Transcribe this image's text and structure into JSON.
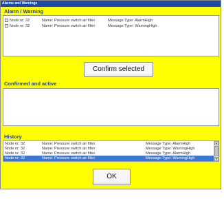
{
  "window": {
    "title": "Alarms and Warnings"
  },
  "alarm_section": {
    "label": "Alarm / Warning",
    "items": [
      {
        "node": "Node nr: 32",
        "name": "Name: Pressure switch air filter",
        "type": "Message Type: AlarmHigh"
      },
      {
        "node": "Node nr: 32",
        "name": "Name: Pressure switch air filter",
        "type": "Message Type: WarningHigh"
      }
    ]
  },
  "confirm_button": {
    "label": "Confirm selected"
  },
  "confirmed_section": {
    "label": "Confirmed and active"
  },
  "history_section": {
    "label": "History",
    "items": [
      {
        "node": "Node nr: 32",
        "name": "Name: Pressure switch air filter",
        "type": "Message Type: AlarmHigh"
      },
      {
        "node": "Node nr: 32",
        "name": "Name: Pressure switch air filter",
        "type": "Message Type: WarningHigh"
      },
      {
        "node": "Node nr: 32",
        "name": "Name: Pressure switch air filter",
        "type": "Message Type: AlarmHigh"
      },
      {
        "node": "Node nr: 32",
        "name": "Name: Pressure switch air filter",
        "type": "Message Type: WarningHigh"
      }
    ],
    "selected_index": 3
  },
  "ok_button": {
    "label": "OK"
  },
  "colors": {
    "background": "#ffff00",
    "titlebar": "#1f4aa8",
    "section_label": "#1f3f9a",
    "selection": "#3a78d4"
  }
}
